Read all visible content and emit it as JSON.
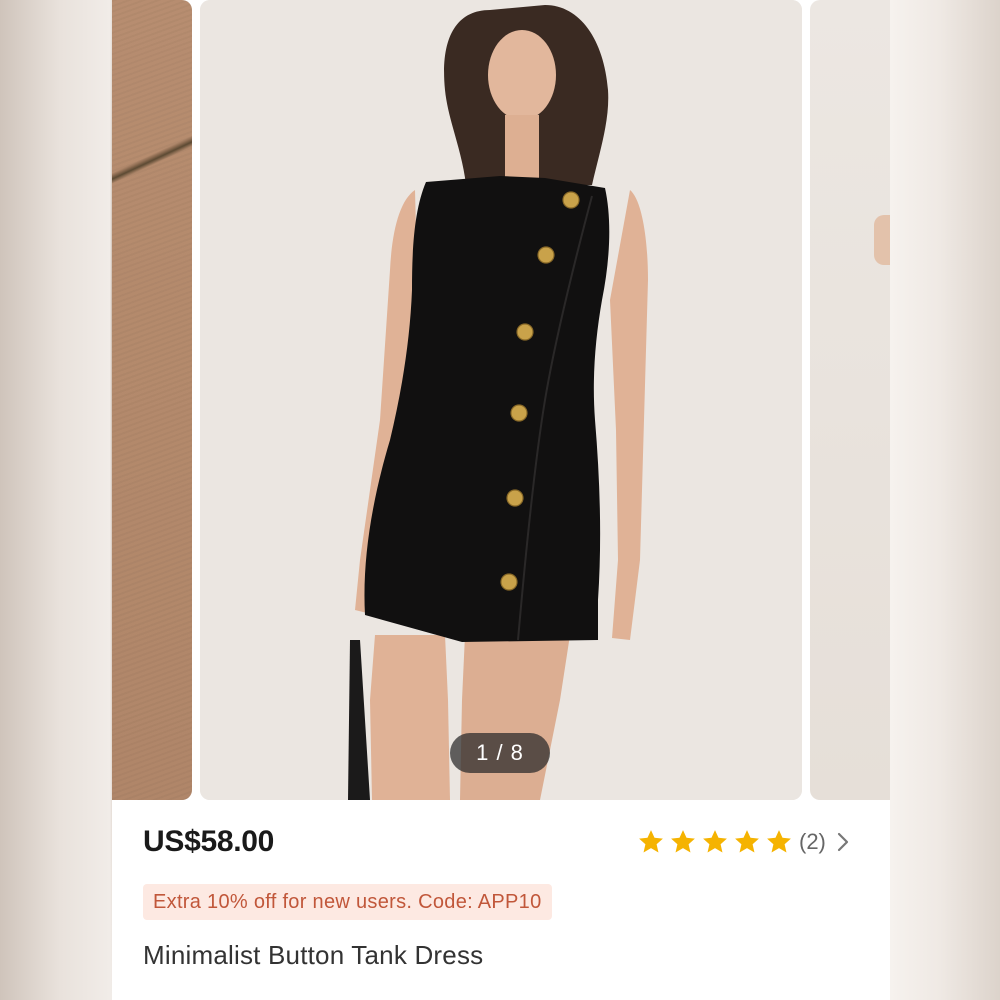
{
  "carousel": {
    "counter": "1 / 8",
    "current": 1,
    "total": 8
  },
  "product": {
    "price": "US$58.00",
    "rating_stars": 5,
    "rating_count": "(2)",
    "promo": "Extra 10% off for new users. Code: APP10",
    "title": "Minimalist Button Tank Dress"
  },
  "colors": {
    "star": "#f5b301",
    "promo_bg": "#fde9e2",
    "promo_text": "#c1573a",
    "price_text": "#1a1a1a"
  },
  "icons": [
    "star-icon",
    "chevron-right-icon"
  ]
}
